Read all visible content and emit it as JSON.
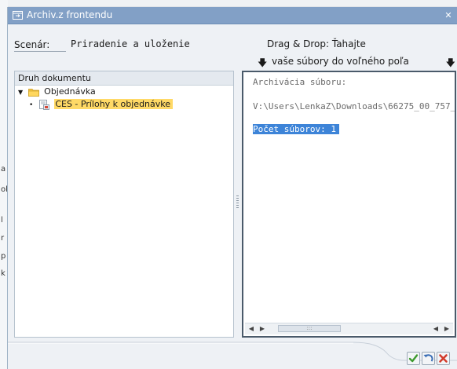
{
  "dialog": {
    "title": "Archiv.z frontendu",
    "close_icon": "close-icon"
  },
  "scenario": {
    "label": "Scenár:",
    "value": "Priradenie a uloženie"
  },
  "drag_drop": {
    "line1": "Drag & Drop: Ťahajte",
    "line2": "vaše súbory do voľného poľa"
  },
  "tree": {
    "header": "Druh dokumentu",
    "nodes": [
      {
        "label": "Objednávka",
        "icon": "folder-icon",
        "expanded": true,
        "level": 0
      },
      {
        "label": "CES - Prílohy k objednávke",
        "icon": "document-icon",
        "selected": true,
        "level": 1
      }
    ]
  },
  "log": {
    "lines": [
      "Archivácia súboru:",
      "V:\\Users\\LenkaZ\\Downloads\\66275_00_757_",
      "Počet súborov:      1"
    ]
  },
  "background": {
    "fragments": [
      "a",
      "ok",
      "l",
      "r",
      "p",
      "k"
    ]
  },
  "actions": [
    {
      "icon": "check-icon",
      "color": "#3d9a2e"
    },
    {
      "icon": "undo-icon",
      "color": "#3b6fb6"
    },
    {
      "icon": "cancel-icon",
      "color": "#d23b2b"
    }
  ],
  "colors": {
    "titlebar": "#82a0c6",
    "selection": "#ffd966",
    "log_highlight": "#3d84d8"
  }
}
